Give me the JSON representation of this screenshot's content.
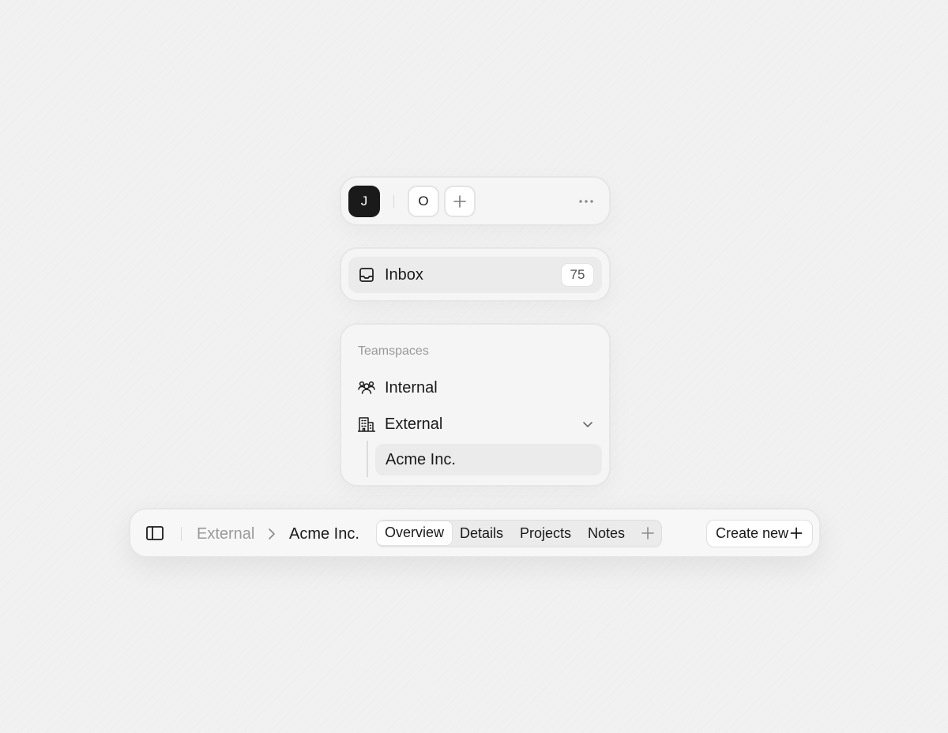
{
  "workspaces": {
    "active_initial": "J",
    "other_initial": "O",
    "add_icon": "plus-icon",
    "more_icon": "more-horizontal-icon"
  },
  "inbox": {
    "icon": "inbox-icon",
    "label": "Inbox",
    "count": "75"
  },
  "teamspaces": {
    "title": "Teamspaces",
    "items": [
      {
        "label": "Internal",
        "icon": "users-icon"
      },
      {
        "label": "External",
        "icon": "building-icon",
        "expanded": true,
        "children": [
          {
            "label": "Acme Inc."
          }
        ]
      }
    ]
  },
  "toolbar": {
    "sidebar_icon": "sidebar-toggle-icon",
    "breadcrumb": {
      "parent": "External",
      "current": "Acme Inc."
    },
    "tabs": [
      {
        "label": "Overview",
        "active": true
      },
      {
        "label": "Details",
        "active": false
      },
      {
        "label": "Projects",
        "active": false
      },
      {
        "label": "Notes",
        "active": false
      }
    ],
    "add_tab_icon": "plus-icon",
    "create_label": "Create new"
  },
  "colors": {
    "background": "#f1f1f1",
    "card": "#f5f5f5",
    "active_workspace": "#1a1a1a",
    "muted_text": "#9a9a9a"
  }
}
